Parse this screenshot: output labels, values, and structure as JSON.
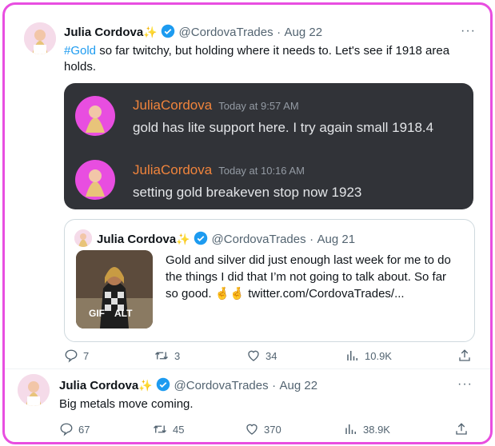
{
  "tweet1": {
    "name": "Julia Cordova",
    "sparkle": "✨",
    "handle": "@CordovaTrades",
    "dot": "·",
    "date": "Aug 22",
    "hashtag": "#Gold",
    "body_line1": " so far twitchy, but holding where it needs to.  Let's see if 1918 area",
    "body_line2": "holds.",
    "discord": [
      {
        "name": "JuliaCordova",
        "time": "Today at 9:57 AM",
        "text": "gold has lite support here.  I try again small 1918.4"
      },
      {
        "name": "JuliaCordova",
        "time": "Today at 10:16 AM",
        "text": "setting gold breakeven stop now 1923"
      }
    ],
    "quote": {
      "name": "Julia Cordova",
      "sparkle": "✨",
      "handle": "@CordovaTrades",
      "dot": "·",
      "date": "Aug 21",
      "line1": "Gold and silver did just enough last week for me to do",
      "line2": "the things I did that I’m not going to talk about. So far",
      "line3": "so good. 🤞🤞  twitter.com/CordovaTrades/...",
      "gif_label": "GIF",
      "alt_label": "ALT"
    },
    "actions": {
      "replies": "7",
      "retweets": "3",
      "likes": "34",
      "views": "10.9K"
    }
  },
  "tweet2": {
    "name": "Julia Cordova",
    "sparkle": "✨",
    "handle": "@CordovaTrades",
    "dot": "·",
    "date": "Aug 22",
    "body": "Big metals move coming.",
    "actions": {
      "replies": "67",
      "retweets": "45",
      "likes": "370",
      "views": "38.9K"
    }
  },
  "more_label": "···",
  "colors": {
    "frame": "#e84ee0",
    "verified": "#1d9bf0",
    "discord_bg": "#313338",
    "discord_name": "#f0843c"
  }
}
